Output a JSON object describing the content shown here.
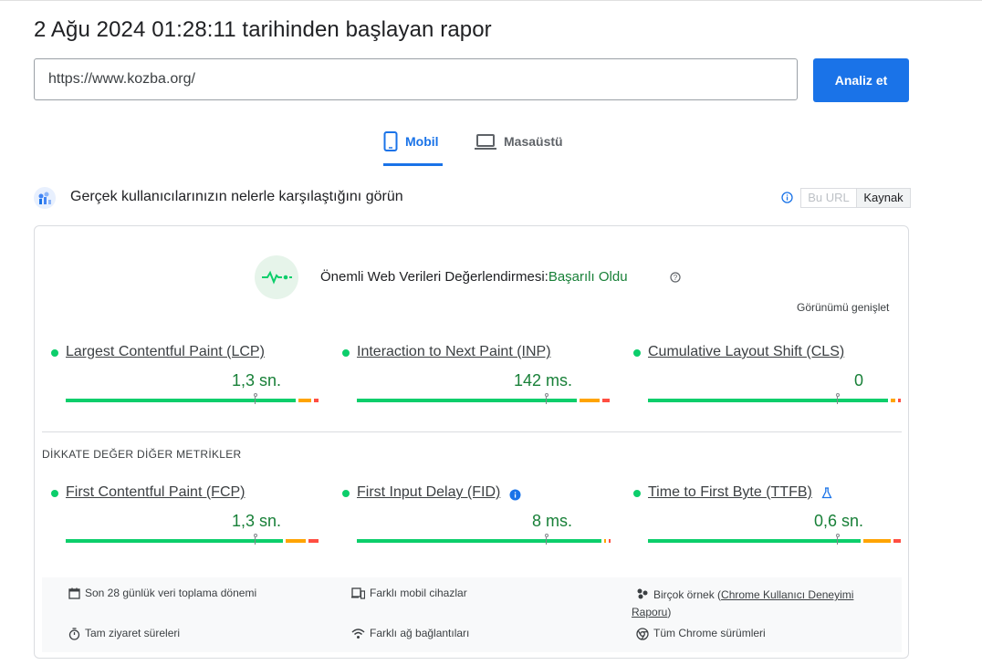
{
  "report_title": "2 Ağu 2024 01:28:11 tarihinden başlayan rapor",
  "url_input": {
    "value": "https://www.kozba.org/"
  },
  "analyze_button": "Analiz et",
  "tabs": [
    {
      "label": "Mobil",
      "icon": "smartphone-icon",
      "active": true
    },
    {
      "label": "Masaüstü",
      "icon": "laptop-icon",
      "active": false
    }
  ],
  "crux": {
    "title": "Gerçek kullanıcılarınızın nelerle karşılaştığını görün",
    "toggle": {
      "this_url": "Bu URL",
      "origin": "Kaynak"
    }
  },
  "assessment": {
    "label": "Önemli Web Verileri Değerlendirmesi:",
    "result": "Başarılı Oldu",
    "expand_link": "Görünümü genişlet"
  },
  "core_metrics": [
    {
      "name": "Largest Contentful Paint (LCP)",
      "value": "1,3 sn.",
      "status": "good",
      "distribution": {
        "good": 0.93,
        "needs_improvement": 0.05,
        "poor": 0.02
      },
      "marker": 0.75
    },
    {
      "name": "Interaction to Next Paint (INP)",
      "value": "142 ms.",
      "status": "good",
      "distribution": {
        "good": 0.89,
        "needs_improvement": 0.08,
        "poor": 0.03
      },
      "marker": 0.75
    },
    {
      "name": "Cumulative Layout Shift (CLS)",
      "value": "0",
      "status": "good",
      "distribution": {
        "good": 0.97,
        "needs_improvement": 0.02,
        "poor": 0.01
      },
      "marker": 0.75
    }
  ],
  "other_metrics_title": "DİKKATE DEĞER DİĞER METRİKLER",
  "other_metrics": [
    {
      "name": "First Contentful Paint (FCP)",
      "value": "1,3 sn.",
      "status": "good",
      "icon": null,
      "distribution": {
        "good": 0.88,
        "needs_improvement": 0.08,
        "poor": 0.04
      },
      "marker": 0.75
    },
    {
      "name": "First Input Delay (FID)",
      "value": "8 ms.",
      "status": "good",
      "icon": "info-icon",
      "distribution": {
        "good": 0.99,
        "needs_improvement": 0.005,
        "poor": 0.005
      },
      "marker": 0.75
    },
    {
      "name": "Time to First Byte (TTFB)",
      "value": "0,6 sn.",
      "status": "good",
      "icon": "experimental-flask-icon",
      "distribution": {
        "good": 0.86,
        "needs_improvement": 0.11,
        "poor": 0.03
      },
      "marker": 0.75
    }
  ],
  "footer": {
    "period": "Son 28 günlük veri toplama dönemi",
    "devices": "Farklı mobil cihazlar",
    "samples_prefix": "Birçok örnek (",
    "samples_link": "Chrome Kullanıcı Deneyimi Raporu",
    "samples_suffix": ")",
    "visit_durations": "Tam ziyaret süreleri",
    "networks": "Farklı ağ bağlantıları",
    "chrome_versions": "Tüm Chrome sürümleri"
  },
  "colors": {
    "accent": "#1a73e8",
    "good": "#0cce6b",
    "needs_improvement": "#ffa400",
    "poor": "#ff4e42",
    "pass_text": "#188038"
  }
}
